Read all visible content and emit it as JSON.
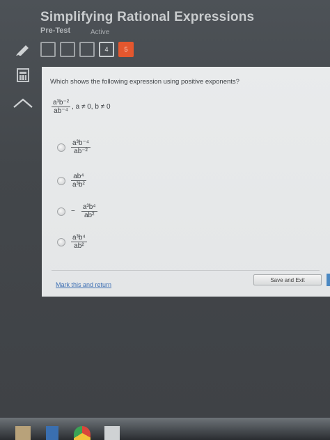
{
  "header": {
    "title": "Simplifying Rational Expressions",
    "subtitle": "Pre-Test",
    "status": "Active"
  },
  "question_nav": [
    {
      "label": "",
      "state": "done"
    },
    {
      "label": "",
      "state": "done"
    },
    {
      "label": "",
      "state": "done"
    },
    {
      "label": "4",
      "state": "current"
    },
    {
      "label": "5",
      "state": "active"
    }
  ],
  "question": {
    "prompt": "Which shows the following expression using positive exponents?",
    "expression": {
      "numerator": "a³b⁻²",
      "denominator": "ab⁻⁴",
      "condition": ", a ≠ 0, b ≠ 0"
    }
  },
  "options": [
    {
      "sign": "",
      "numerator": "a³b⁻⁴",
      "denominator": "ab⁻²"
    },
    {
      "sign": "",
      "numerator": "ab⁴",
      "denominator": "a³b²"
    },
    {
      "sign": "−",
      "numerator": "a³b⁴",
      "denominator": "ab²"
    },
    {
      "sign": "",
      "numerator": "a³b⁴",
      "denominator": "ab²"
    }
  ],
  "footer": {
    "mark_link": "Mark this and return",
    "save_label": "Save and Exit"
  },
  "colors": {
    "accent": "#e4572e",
    "link": "#3d6fb3",
    "panel": "#e6e8e9",
    "chrome": "#45494d"
  }
}
